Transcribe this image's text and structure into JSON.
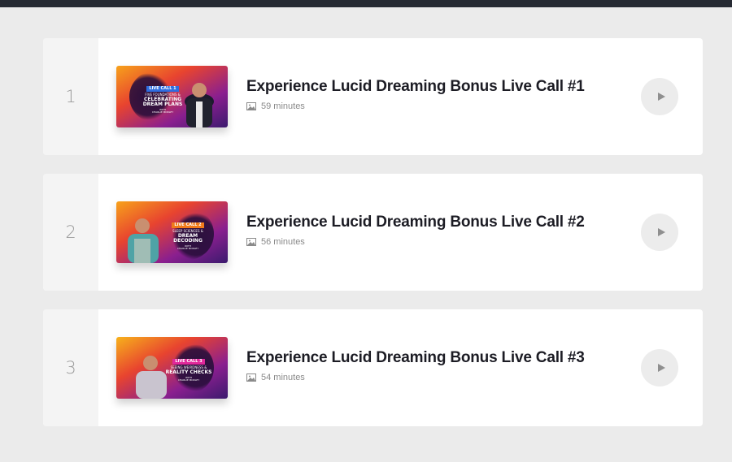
{
  "lessons": [
    {
      "index": "1",
      "title": "Experience Lucid Dreaming Bonus Live Call #1",
      "duration": "59 minutes",
      "thumbnail": {
        "tag": "LIVE CALL 1",
        "line1": "FIVE FOUNDATIONS &",
        "line2": "CELEBRATING",
        "line3": "DREAM PLANS",
        "with": "WITH",
        "host": "CHARLIE MORLEY",
        "tag_color": "#2f6de0"
      }
    },
    {
      "index": "2",
      "title": "Experience Lucid Dreaming Bonus Live Call #2",
      "duration": "56 minutes",
      "thumbnail": {
        "tag": "LIVE CALL 2",
        "line1": "SLEEP SCIENCES &",
        "line2": "DREAM",
        "line3": "DECODING",
        "with": "WITH",
        "host": "CHARLIE MORLEY",
        "tag_color": "#f07a1a"
      }
    },
    {
      "index": "3",
      "title": "Experience Lucid Dreaming Bonus Live Call #3",
      "duration": "54 minutes",
      "thumbnail": {
        "tag": "LIVE CALL 3",
        "line1": "SEEING WEIRDNESS &",
        "line2": "REALITY CHECKS",
        "line3": "",
        "with": "WITH",
        "host": "CHARLIE MORLEY",
        "tag_color": "#e0289a"
      }
    }
  ],
  "icons": {
    "duration_icon": "image-icon",
    "play_icon": "play-icon"
  }
}
